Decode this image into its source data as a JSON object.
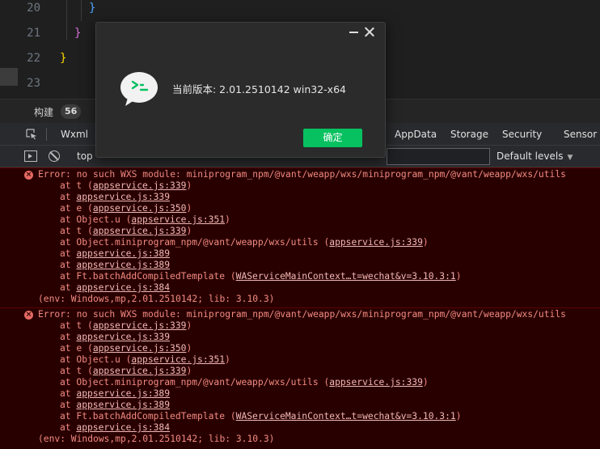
{
  "editor": {
    "lines": [
      {
        "num": "20",
        "code": "}"
      },
      {
        "num": "21",
        "code": "}"
      },
      {
        "num": "22",
        "code": "}"
      },
      {
        "num": "23",
        "code": ""
      }
    ]
  },
  "build": {
    "label": "构建",
    "count": "56"
  },
  "devtools": {
    "tabs": [
      "Wxml",
      "AppData",
      "Storage",
      "Security",
      "Sensor"
    ]
  },
  "console_toolbar": {
    "context": "top",
    "filter_placeholder": "",
    "levels": "Default levels",
    "levels_caret": "▼"
  },
  "errors": [
    {
      "message": "Error: no such WXS module: miniprogram_npm/@vant/weapp/wxs/miniprogram_npm/@vant/weapp/wxs/utils",
      "stack": [
        {
          "prefix": "at t (",
          "link": "appservice.js:339",
          "suffix": ")"
        },
        {
          "prefix": "at ",
          "link": "appservice.js:339",
          "suffix": ""
        },
        {
          "prefix": "at e (",
          "link": "appservice.js:350",
          "suffix": ")"
        },
        {
          "prefix": "at Object.u (",
          "link": "appservice.js:351",
          "suffix": ")"
        },
        {
          "prefix": "at t (",
          "link": "appservice.js:339",
          "suffix": ")"
        },
        {
          "prefix": "at Object.miniprogram_npm/@vant/weapp/wxs/utils (",
          "link": "appservice.js:339",
          "suffix": ")"
        },
        {
          "prefix": "at ",
          "link": "appservice.js:389",
          "suffix": ""
        },
        {
          "prefix": "at ",
          "link": "appservice.js:389",
          "suffix": ""
        },
        {
          "prefix": "at Ft.batchAddCompiledTemplate (",
          "link": "WAServiceMainContext…t=wechat&v=3.10.3:1",
          "suffix": ")"
        },
        {
          "prefix": "at ",
          "link": "appservice.js:384",
          "suffix": ""
        }
      ],
      "env": "(env: Windows,mp,2.01.2510142; lib: 3.10.3)"
    },
    {
      "message": "Error: no such WXS module: miniprogram_npm/@vant/weapp/wxs/miniprogram_npm/@vant/weapp/wxs/utils",
      "stack": [
        {
          "prefix": "at t (",
          "link": "appservice.js:339",
          "suffix": ")"
        },
        {
          "prefix": "at ",
          "link": "appservice.js:339",
          "suffix": ""
        },
        {
          "prefix": "at e (",
          "link": "appservice.js:350",
          "suffix": ")"
        },
        {
          "prefix": "at Object.u (",
          "link": "appservice.js:351",
          "suffix": ")"
        },
        {
          "prefix": "at t (",
          "link": "appservice.js:339",
          "suffix": ")"
        },
        {
          "prefix": "at Object.miniprogram_npm/@vant/weapp/wxs/utils (",
          "link": "appservice.js:339",
          "suffix": ")"
        },
        {
          "prefix": "at ",
          "link": "appservice.js:389",
          "suffix": ""
        },
        {
          "prefix": "at ",
          "link": "appservice.js:389",
          "suffix": ""
        },
        {
          "prefix": "at Ft.batchAddCompiledTemplate (",
          "link": "WAServiceMainContext…t=wechat&v=3.10.3:1",
          "suffix": ")"
        },
        {
          "prefix": "at ",
          "link": "appservice.js:384",
          "suffix": ""
        }
      ],
      "env": "(env: Windows,mp,2.01.2510142; lib: 3.10.3)"
    }
  ],
  "dialog": {
    "version_text": "当前版本: 2.01.2510142 win32-x64",
    "ok_label": "确定",
    "icon": "wechat-devtools-logo-icon"
  },
  "colors": {
    "error_text": "#f28b82",
    "error_bg": "#290000",
    "ok_button": "#07c160",
    "brace_blue": "#4fa6ff",
    "brace_pink": "#d670d6",
    "brace_yellow": "#ffd700"
  }
}
